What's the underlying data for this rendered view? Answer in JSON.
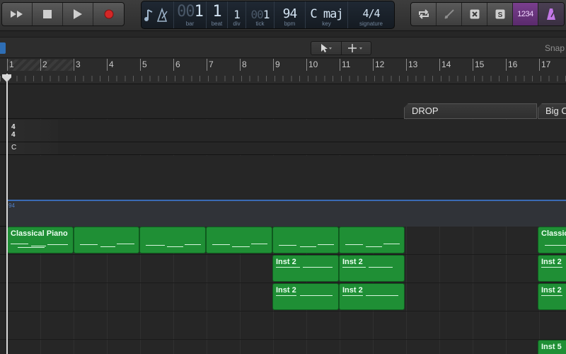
{
  "lcd": {
    "bar": "1",
    "beat": "1",
    "div": "1",
    "tick": "1",
    "bpm": "94",
    "key": "C maj",
    "signature": "4/4",
    "labels": {
      "bar": "bar",
      "beat": "beat",
      "div": "div",
      "tick": "tick",
      "bpm": "bpm",
      "key": "key",
      "signature": "signature"
    }
  },
  "transport": {
    "rewind_icon": "fast-forward-icon",
    "stop_icon": "stop-icon",
    "play_icon": "play-icon",
    "record_icon": "record-icon"
  },
  "right_tools": {
    "count_in_label": "1234"
  },
  "toolbar": {
    "snap_label": "Snap"
  },
  "ruler": {
    "bars": [
      "1",
      "2",
      "3",
      "4",
      "5",
      "6",
      "7",
      "8",
      "9",
      "10",
      "11",
      "12",
      "13",
      "14",
      "15",
      "16",
      "17"
    ]
  },
  "markers": [
    {
      "label": "DROP"
    },
    {
      "label": "Big C"
    }
  ],
  "signature_lane": {
    "numerator": "4",
    "denominator": "4",
    "key": "C"
  },
  "tempo_lane": {
    "value": "94"
  },
  "regions": {
    "piano": [
      "Classical Piano",
      "",
      "",
      "",
      "",
      "",
      "Classic"
    ],
    "inst2a": [
      "Inst 2",
      "Inst 2",
      "Inst 2"
    ],
    "inst2b": [
      "Inst 2",
      "Inst 2",
      "Inst 2"
    ],
    "inst5": [
      "Inst 5"
    ]
  },
  "colors": {
    "region_green": "#1f8f35",
    "accent_blue": "#2e6eb5",
    "purple": "#7a3f8e",
    "record_red": "#d32727"
  }
}
